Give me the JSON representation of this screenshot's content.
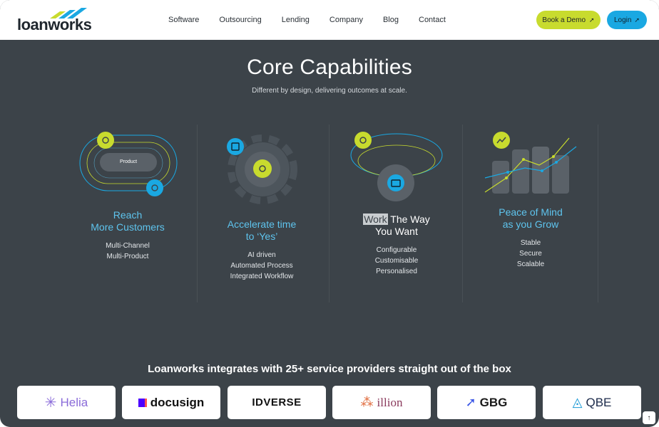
{
  "brand": {
    "name": "loanworks"
  },
  "nav": {
    "items": [
      {
        "label": "Software"
      },
      {
        "label": "Outsourcing"
      },
      {
        "label": "Lending"
      },
      {
        "label": "Company"
      },
      {
        "label": "Blog"
      },
      {
        "label": "Contact"
      }
    ],
    "book_demo": "Book a Demo",
    "login": "Login"
  },
  "hero": {
    "title": "Core Capabilities",
    "subtitle": "Different by design, delivering outcomes at scale."
  },
  "capabilities": [
    {
      "title_line1": "Reach",
      "title_line2": "More Customers",
      "items": [
        "Multi-Channel",
        "Multi-Product"
      ],
      "illustration_label": "Product"
    },
    {
      "title_line1": "Accelerate time",
      "title_line2": "to ‘Yes’",
      "items": [
        "AI driven",
        "Automated Process",
        "Integrated Workflow"
      ]
    },
    {
      "title_highlight": "Work",
      "title_rest": " The Way",
      "title_line2": "You Want",
      "items": [
        "Configurable",
        "Customisable",
        "Personalised"
      ]
    },
    {
      "title_line1": "Peace of Mind",
      "title_line2": "as you Grow",
      "items": [
        "Stable",
        "Secure",
        "Scalable"
      ]
    }
  ],
  "integrations": {
    "title": "Loanworks integrates with 25+ service providers straight out of the box",
    "partners": [
      {
        "name": "Helia"
      },
      {
        "name": "docusign"
      },
      {
        "name": "IDVERSE"
      },
      {
        "name": "illion"
      },
      {
        "name": "GBG"
      },
      {
        "name": "QBE"
      }
    ]
  },
  "colors": {
    "background": "#3c4349",
    "accent_lime": "#c8db2e",
    "accent_blue": "#1aa8e2",
    "heading_blue": "#5ec4ee"
  },
  "icons": {
    "scroll_top": "arrow-up-icon"
  }
}
